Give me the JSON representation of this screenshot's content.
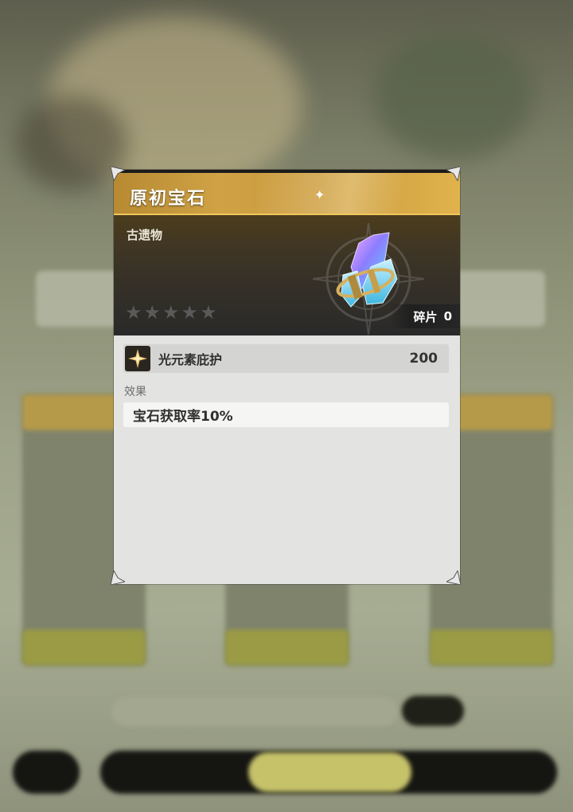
{
  "item": {
    "title": "原初宝石",
    "category": "古遗物",
    "rarity_filled": 0,
    "rarity_max": 5,
    "shards_label": "碎片",
    "shards_count": "0"
  },
  "attribute": {
    "name": "光元素庇护",
    "value": "200",
    "icon": "light-element-icon"
  },
  "effect": {
    "label": "效果",
    "text": "宝石获取率10%"
  },
  "colors": {
    "title_gold": "#c99a3e",
    "panel_bg": "#e3e3e1",
    "hero_dark": "#2a2a2a"
  }
}
